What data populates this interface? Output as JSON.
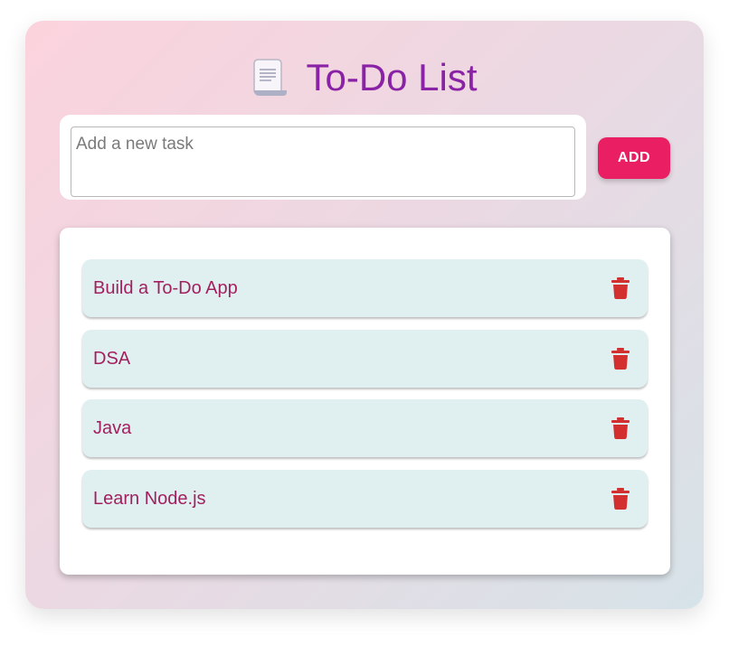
{
  "app": {
    "title": "To-Do List",
    "title_icon": "scroll-document-icon"
  },
  "input": {
    "placeholder": "Add a new task",
    "value": ""
  },
  "add_button": {
    "label": "ADD"
  },
  "tasks": [
    {
      "label": "Build a To-Do App",
      "icon": "trash-icon"
    },
    {
      "label": "DSA",
      "icon": "trash-icon"
    },
    {
      "label": "Java",
      "icon": "trash-icon"
    },
    {
      "label": "Learn Node.js",
      "icon": "trash-icon"
    }
  ],
  "colors": {
    "title": "#8a22a6",
    "accent": "#e91e63",
    "task_text": "#a3205e",
    "task_bg": "#e0f0f1",
    "delete": "#d32f2f"
  }
}
